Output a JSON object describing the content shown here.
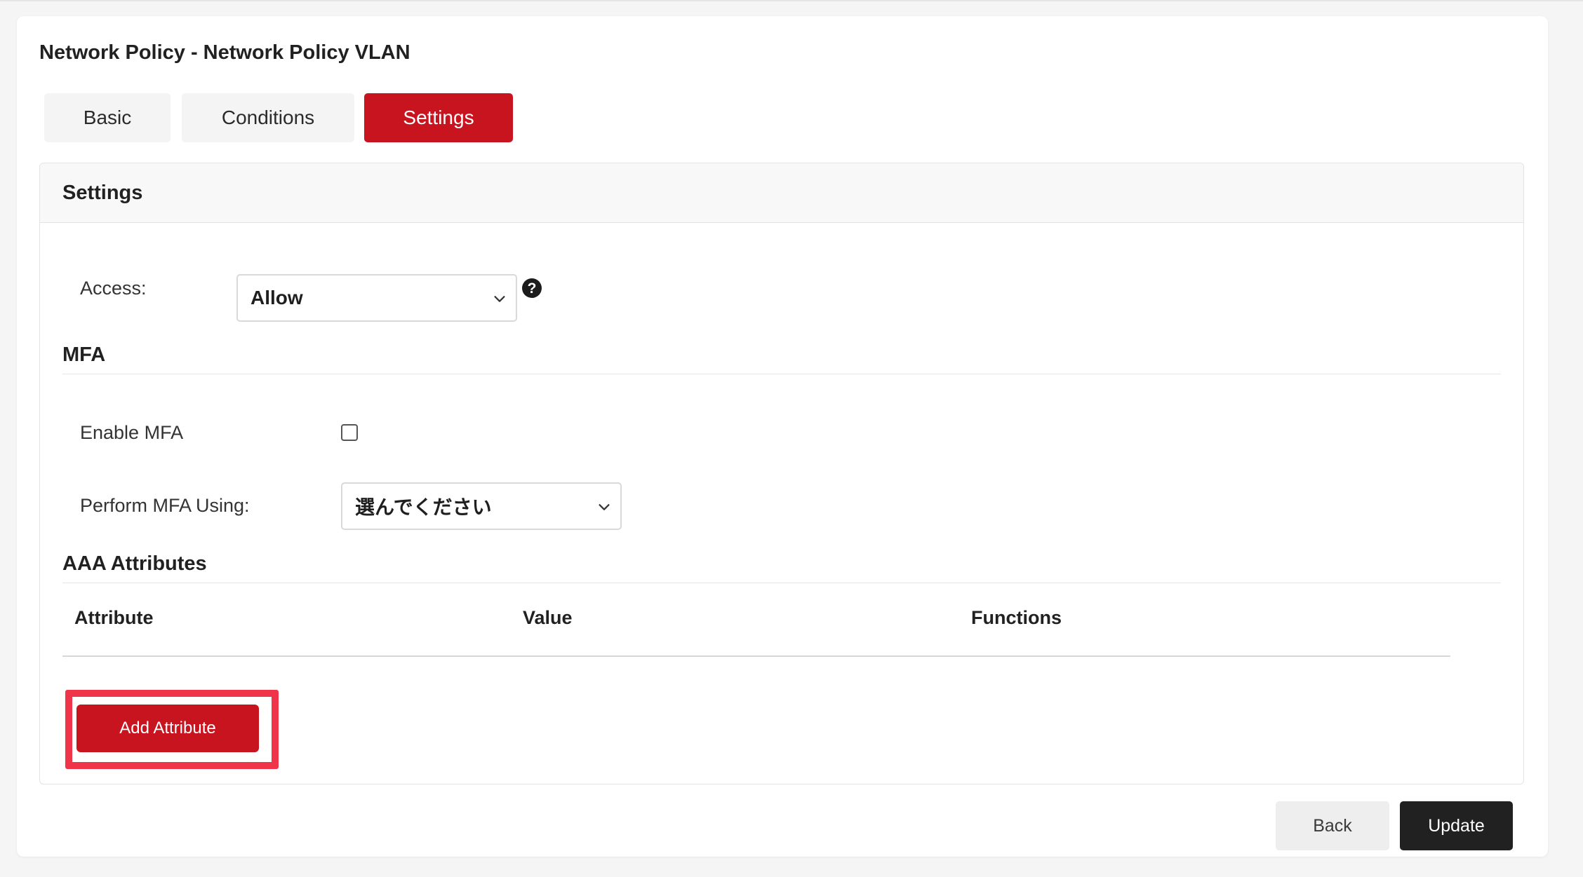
{
  "page": {
    "title": "Network Policy - Network Policy VLAN"
  },
  "tabs": [
    {
      "label": "Basic",
      "active": false
    },
    {
      "label": "Conditions",
      "active": false
    },
    {
      "label": "Settings",
      "active": true
    }
  ],
  "settings": {
    "title": "Settings",
    "access": {
      "label": "Access:",
      "selected": "Allow",
      "help_icon": "help-icon"
    }
  },
  "mfa": {
    "title": "MFA",
    "enable": {
      "label": "Enable MFA",
      "checked": false
    },
    "perform_using": {
      "label": "Perform MFA Using:",
      "selected": "選んでください"
    }
  },
  "aaa": {
    "title": "AAA Attributes",
    "columns": [
      "Attribute",
      "Value",
      "Functions"
    ],
    "rows": [],
    "add_button": "Add Attribute"
  },
  "footer": {
    "back_label": "Back",
    "update_label": "Update"
  },
  "colors": {
    "accent": "#c8141e",
    "highlight": "#f0354a",
    "dark_button": "#212121"
  }
}
